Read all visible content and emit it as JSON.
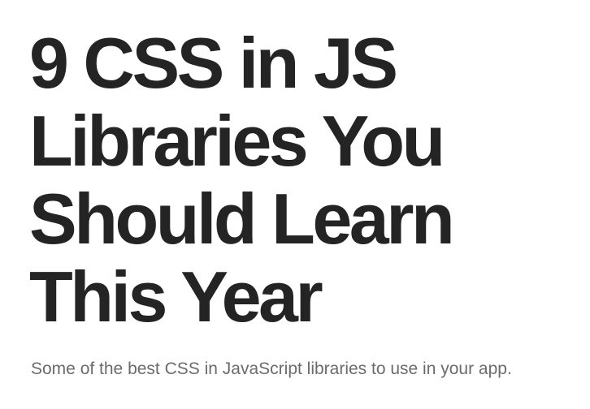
{
  "article": {
    "title_lines": [
      "9 CSS in JS",
      "Libraries You",
      "Should Learn",
      "This Year"
    ],
    "subtitle": "Some of the best CSS in JavaScript libraries to use in your app."
  }
}
